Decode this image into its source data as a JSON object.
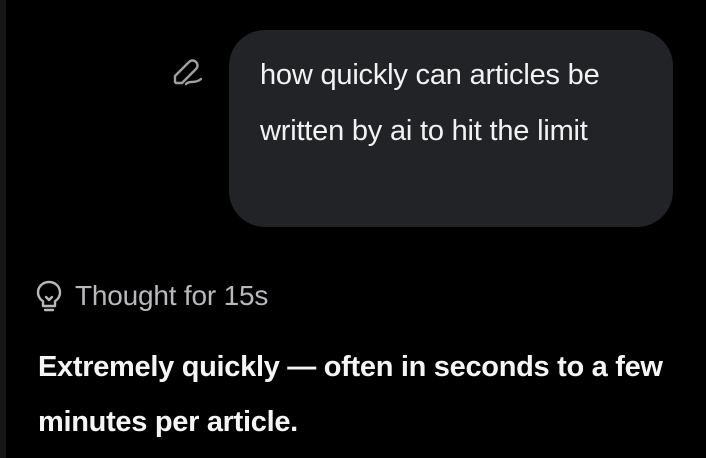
{
  "conversation": {
    "user_message": "how quickly can articles be written by ai to hit the limit",
    "thought_label": "Thought for 15s",
    "answer_text": "Extremely quickly — often in seconds to a few minutes per article."
  },
  "icons": {
    "edit": "pencil-edit-icon",
    "thought": "lightbulb-icon"
  },
  "colors": {
    "background": "#000000",
    "bubble": "#222327",
    "muted_text": "#b9b9bd"
  }
}
